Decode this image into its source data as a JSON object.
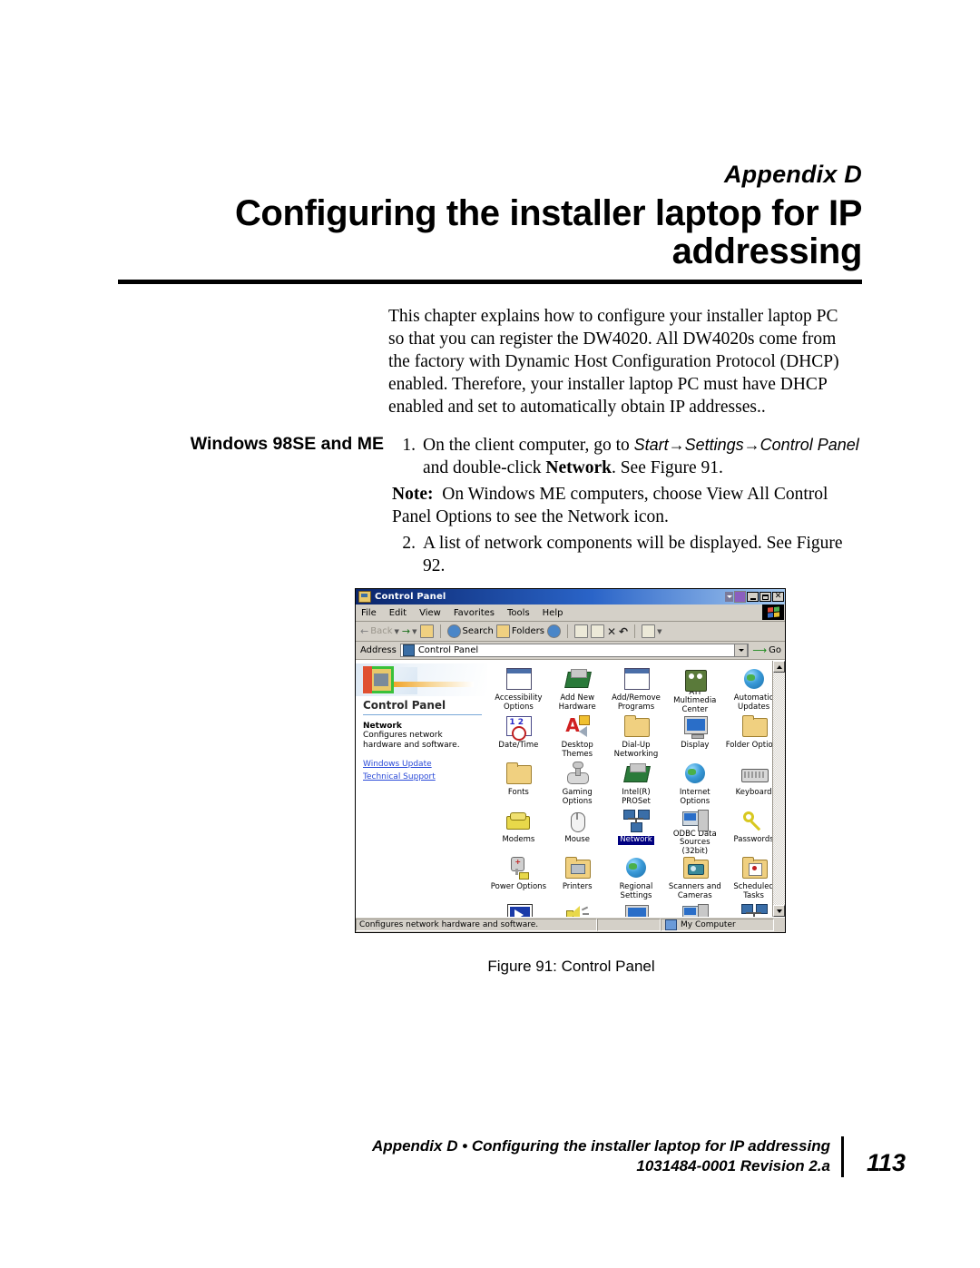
{
  "page": {
    "appendix_label": "Appendix D",
    "chapter_title": "Configuring the installer laptop for IP addressing",
    "intro": "This chapter explains how to configure your installer laptop PC so that you can register the DW4020. All DW4020s come from the factory with Dynamic Host Configuration Protocol (DHCP) enabled.  Therefore, your installer laptop PC must have DHCP enabled and set to automatically obtain IP addresses.."
  },
  "section": {
    "side_heading": "Windows 98SE and ME",
    "step1": {
      "num": "1.",
      "part1": "On the client computer, go to ",
      "path": "Start→Settings→Control Panel",
      "part2": " and double-click ",
      "bold": "Network",
      "part3": ". See Figure 91."
    },
    "note": {
      "label": "Note:",
      "text": "On Windows ME computers, choose View All Control Panel Options to see the Network icon."
    },
    "step2": {
      "num": "2.",
      "text": "A list of network components will be displayed. See Figure 92."
    }
  },
  "figure": {
    "caption": "Figure 91:  Control Panel"
  },
  "window": {
    "title": "Control Panel",
    "menu": [
      "File",
      "Edit",
      "View",
      "Favorites",
      "Tools",
      "Help"
    ],
    "toolbar": {
      "back": "Back",
      "search": "Search",
      "folders": "Folders"
    },
    "address": {
      "label": "Address",
      "value": "Control Panel",
      "go": "Go"
    },
    "left_pane": {
      "heading": "Control Panel",
      "item_title": "Network",
      "item_desc": "Configures network hardware and software.",
      "links": [
        "Windows Update",
        "Technical Support"
      ]
    },
    "icons": [
      {
        "label": "Accessibility Options",
        "glyph": "window",
        "selected": false
      },
      {
        "label": "Add New Hardware",
        "glyph": "card",
        "selected": false
      },
      {
        "label": "Add/Remove Programs",
        "glyph": "window",
        "selected": false
      },
      {
        "label": "ATI Multimedia Center",
        "glyph": "cube",
        "selected": false
      },
      {
        "label": "Automatic Updates",
        "glyph": "globe",
        "selected": false
      },
      {
        "label": "Date/Time",
        "glyph": "clock",
        "selected": false
      },
      {
        "label": "Desktop Themes",
        "glyph": "letterA",
        "selected": false
      },
      {
        "label": "Dial-Up Networking",
        "glyph": "folder",
        "selected": false
      },
      {
        "label": "Display",
        "glyph": "monitor",
        "selected": false
      },
      {
        "label": "Folder Options",
        "glyph": "folder",
        "selected": false
      },
      {
        "label": "Fonts",
        "glyph": "folder",
        "selected": false
      },
      {
        "label": "Gaming Options",
        "glyph": "joystick",
        "selected": false
      },
      {
        "label": "Intel(R) PROSet",
        "glyph": "card",
        "selected": false
      },
      {
        "label": "Internet Options",
        "glyph": "globe",
        "selected": false
      },
      {
        "label": "Keyboard",
        "glyph": "keyboard",
        "selected": false
      },
      {
        "label": "Modems",
        "glyph": "modem",
        "selected": false
      },
      {
        "label": "Mouse",
        "glyph": "mouse",
        "selected": false
      },
      {
        "label": "Network",
        "glyph": "network",
        "selected": true
      },
      {
        "label": "ODBC Data Sources (32bit)",
        "glyph": "server",
        "selected": false
      },
      {
        "label": "Passwords",
        "glyph": "key",
        "selected": false
      },
      {
        "label": "Power Options",
        "glyph": "plug",
        "selected": false
      },
      {
        "label": "Printers",
        "glyph": "printer",
        "selected": false
      },
      {
        "label": "Regional Settings",
        "glyph": "globe",
        "selected": false
      },
      {
        "label": "Scanners and Cameras",
        "glyph": "camera",
        "selected": false
      },
      {
        "label": "Scheduled Tasks",
        "glyph": "tasks",
        "selected": false
      },
      {
        "label": "",
        "glyph": "play",
        "selected": false
      },
      {
        "label": "",
        "glyph": "speaker",
        "selected": false
      },
      {
        "label": "",
        "glyph": "monitor",
        "selected": false
      },
      {
        "label": "",
        "glyph": "server",
        "selected": false
      },
      {
        "label": "",
        "glyph": "network",
        "selected": false
      }
    ],
    "status": {
      "text": "Configures network hardware and software.",
      "zone": "My Computer"
    }
  },
  "footer": {
    "line1": "Appendix D • Configuring the installer laptop for IP addressing",
    "line2": "1031484-0001  Revision 2.a",
    "page": "113"
  }
}
